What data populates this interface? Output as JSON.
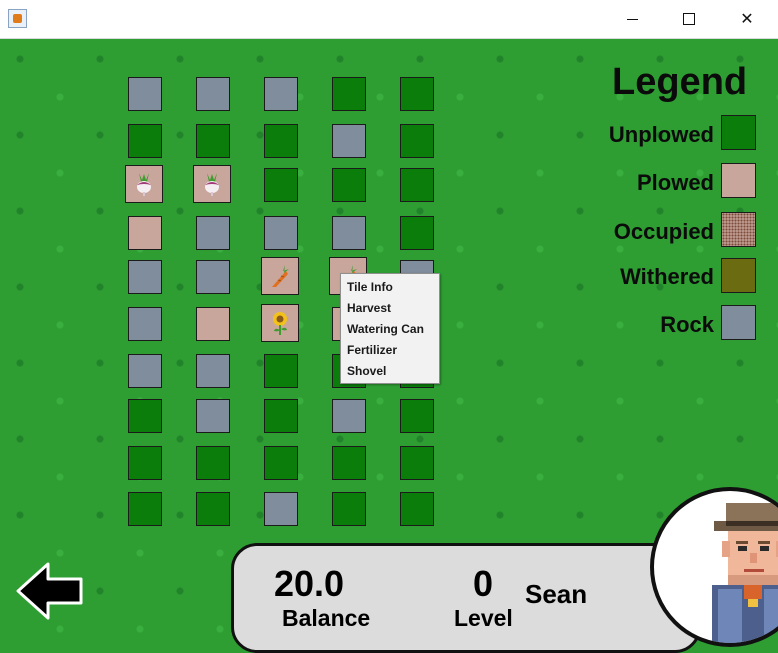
{
  "window": {
    "icon": "java-cup-icon",
    "controls": [
      "minimize",
      "maximize",
      "close"
    ],
    "min_glyph": "",
    "max_glyph": "",
    "close_glyph": "✕"
  },
  "farm": {
    "columns": 5,
    "rows": 10,
    "tiles": [
      [
        "rock",
        "rock",
        "rock",
        "unplowed",
        "unplowed"
      ],
      [
        "unplowed",
        "unplowed",
        "unplowed",
        "rock",
        "unplowed"
      ],
      [
        "turnip",
        "turnip",
        "unplowed",
        "unplowed",
        "unplowed"
      ],
      [
        "plowed",
        "rock",
        "rock",
        "rock",
        "unplowed"
      ],
      [
        "rock",
        "rock",
        "carrot",
        "carrot",
        "rock"
      ],
      [
        "rock",
        "plowed",
        "sunflower",
        "plowed",
        "unplowed"
      ],
      [
        "rock",
        "rock",
        "unplowed",
        "unplowed",
        "unplowed"
      ],
      [
        "unplowed",
        "rock",
        "unplowed",
        "rock",
        "unplowed"
      ],
      [
        "unplowed",
        "unplowed",
        "unplowed",
        "unplowed",
        "unplowed"
      ],
      [
        "unplowed",
        "unplowed",
        "rock",
        "unplowed",
        "unplowed"
      ]
    ]
  },
  "context_menu": {
    "items": [
      "Tile Info",
      "Harvest",
      "Watering Can",
      "Fertilizer",
      "Shovel"
    ]
  },
  "legend": {
    "title": "Legend",
    "items": [
      {
        "label": "Unplowed",
        "color": "#0a7d0a"
      },
      {
        "label": "Plowed",
        "color": "#c9a69b"
      },
      {
        "label": "Occupied",
        "color": "#c9a69b"
      },
      {
        "label": "Withered",
        "color": "#6b6b12"
      },
      {
        "label": "Rock",
        "color": "#7f8d9c"
      }
    ]
  },
  "stats": {
    "balance_value": "20.0",
    "balance_label": "Balance",
    "level_value": "0",
    "level_label": "Level",
    "player_name": "Sean"
  },
  "colors": {
    "grass": "#2e9e33",
    "unplowed": "#0a7d0a",
    "plowed": "#c9a69b",
    "rock": "#7f8d9c",
    "withered": "#6b6b12",
    "panel": "#dcdcdc"
  },
  "icons": {
    "back": "back-arrow-icon",
    "avatar": "farmer-avatar"
  }
}
